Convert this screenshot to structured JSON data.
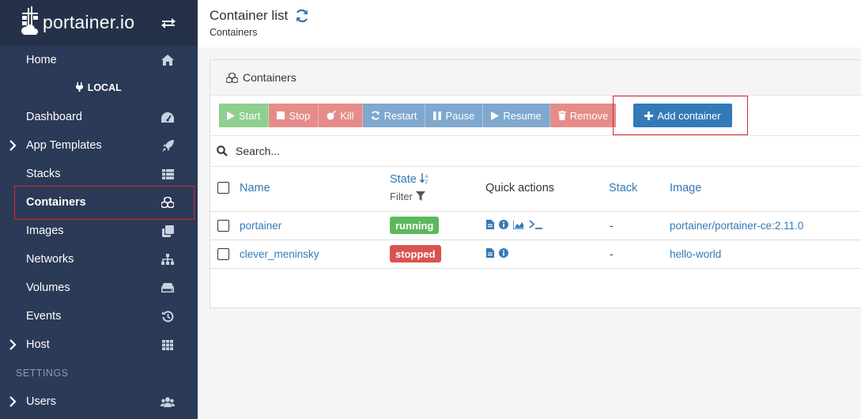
{
  "app": {
    "logo_text": "portainer.io"
  },
  "sidebar": {
    "items": [
      {
        "label": "Home",
        "icon": "home-icon"
      },
      {
        "label": "LOCAL",
        "icon": "plug-icon"
      },
      {
        "label": "Dashboard",
        "icon": "tachometer-icon"
      },
      {
        "label": "App Templates",
        "icon": "rocket-icon"
      },
      {
        "label": "Stacks",
        "icon": "th-list-icon"
      },
      {
        "label": "Containers",
        "icon": "cubes-icon"
      },
      {
        "label": "Images",
        "icon": "clone-icon"
      },
      {
        "label": "Networks",
        "icon": "sitemap-icon"
      },
      {
        "label": "Volumes",
        "icon": "hdd-icon"
      },
      {
        "label": "Events",
        "icon": "history-icon"
      },
      {
        "label": "Host",
        "icon": "th-icon"
      },
      {
        "label": "Users",
        "icon": "users-icon"
      }
    ],
    "settings_label": "SETTINGS",
    "active": "Containers"
  },
  "header": {
    "title": "Container list",
    "breadcrumb": "Containers"
  },
  "panel": {
    "heading": "Containers",
    "toolbar": {
      "start": "Start",
      "stop": "Stop",
      "kill": "Kill",
      "restart": "Restart",
      "pause": "Pause",
      "resume": "Resume",
      "remove": "Remove",
      "add": "Add container"
    },
    "search_placeholder": "Search...",
    "columns": {
      "name": "Name",
      "state": "State",
      "filter": "Filter",
      "quick_actions": "Quick actions",
      "stack": "Stack",
      "image": "Image"
    },
    "rows": [
      {
        "name": "portainer",
        "state": "running",
        "stack": "-",
        "image": "portainer/portainer-ce:2.11.0"
      },
      {
        "name": "clever_meninsky",
        "state": "stopped",
        "stack": "-",
        "image": "hello-world"
      }
    ]
  },
  "colors": {
    "sidebar": "#2b3a56",
    "running": "#5cb85c",
    "stopped": "#d9534f",
    "primary": "#337ab7",
    "highlight": "#d9262c"
  }
}
